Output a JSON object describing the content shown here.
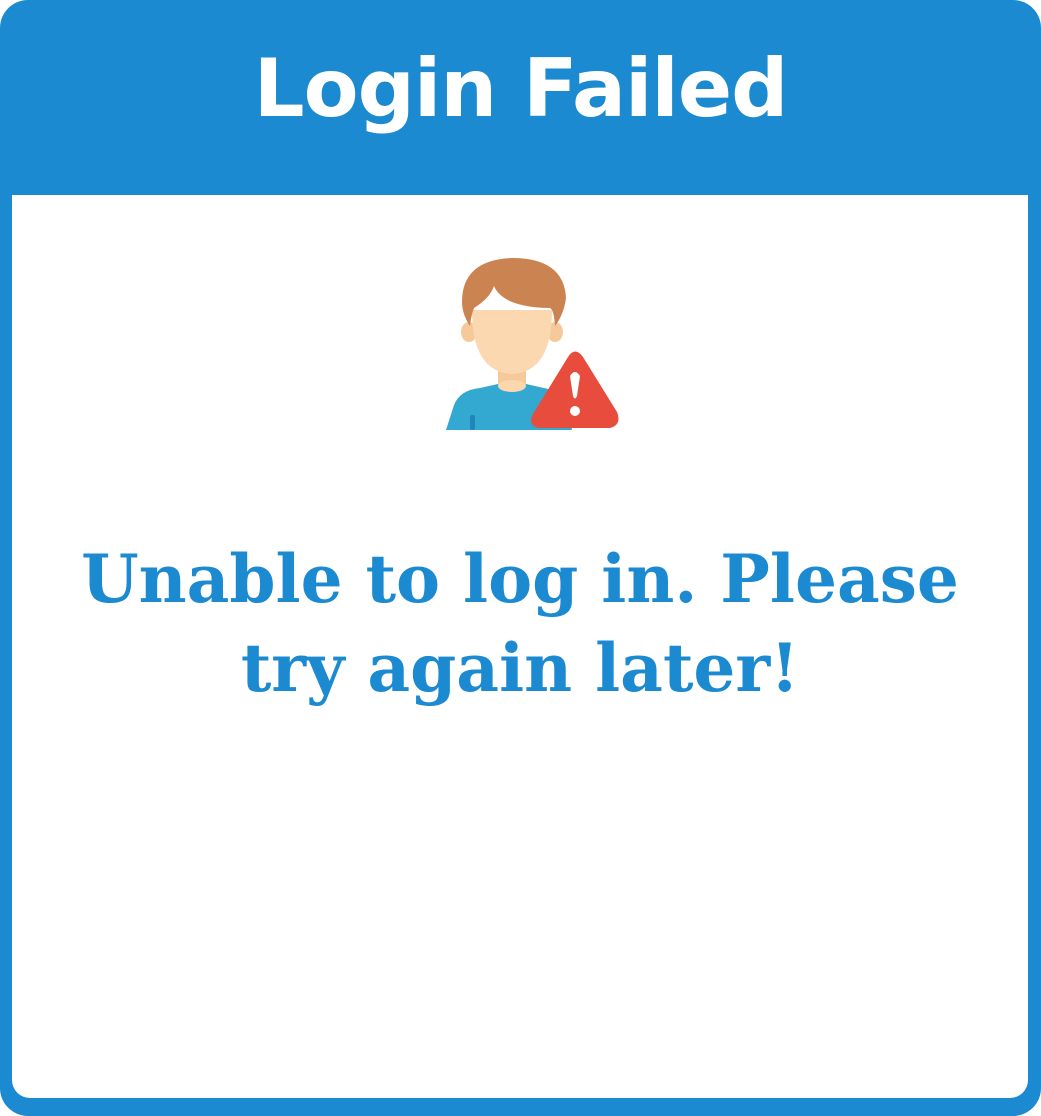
{
  "dialog": {
    "title": "Login Failed",
    "message": "Unable to log in. Please try again later!",
    "illustration_icon": "user-warning-icon",
    "colors": {
      "frame": "#1b8ad0",
      "title_text": "#ffffff",
      "message_text": "#1b8ad0",
      "background": "#ffffff",
      "warning": "#e74c3c"
    }
  }
}
